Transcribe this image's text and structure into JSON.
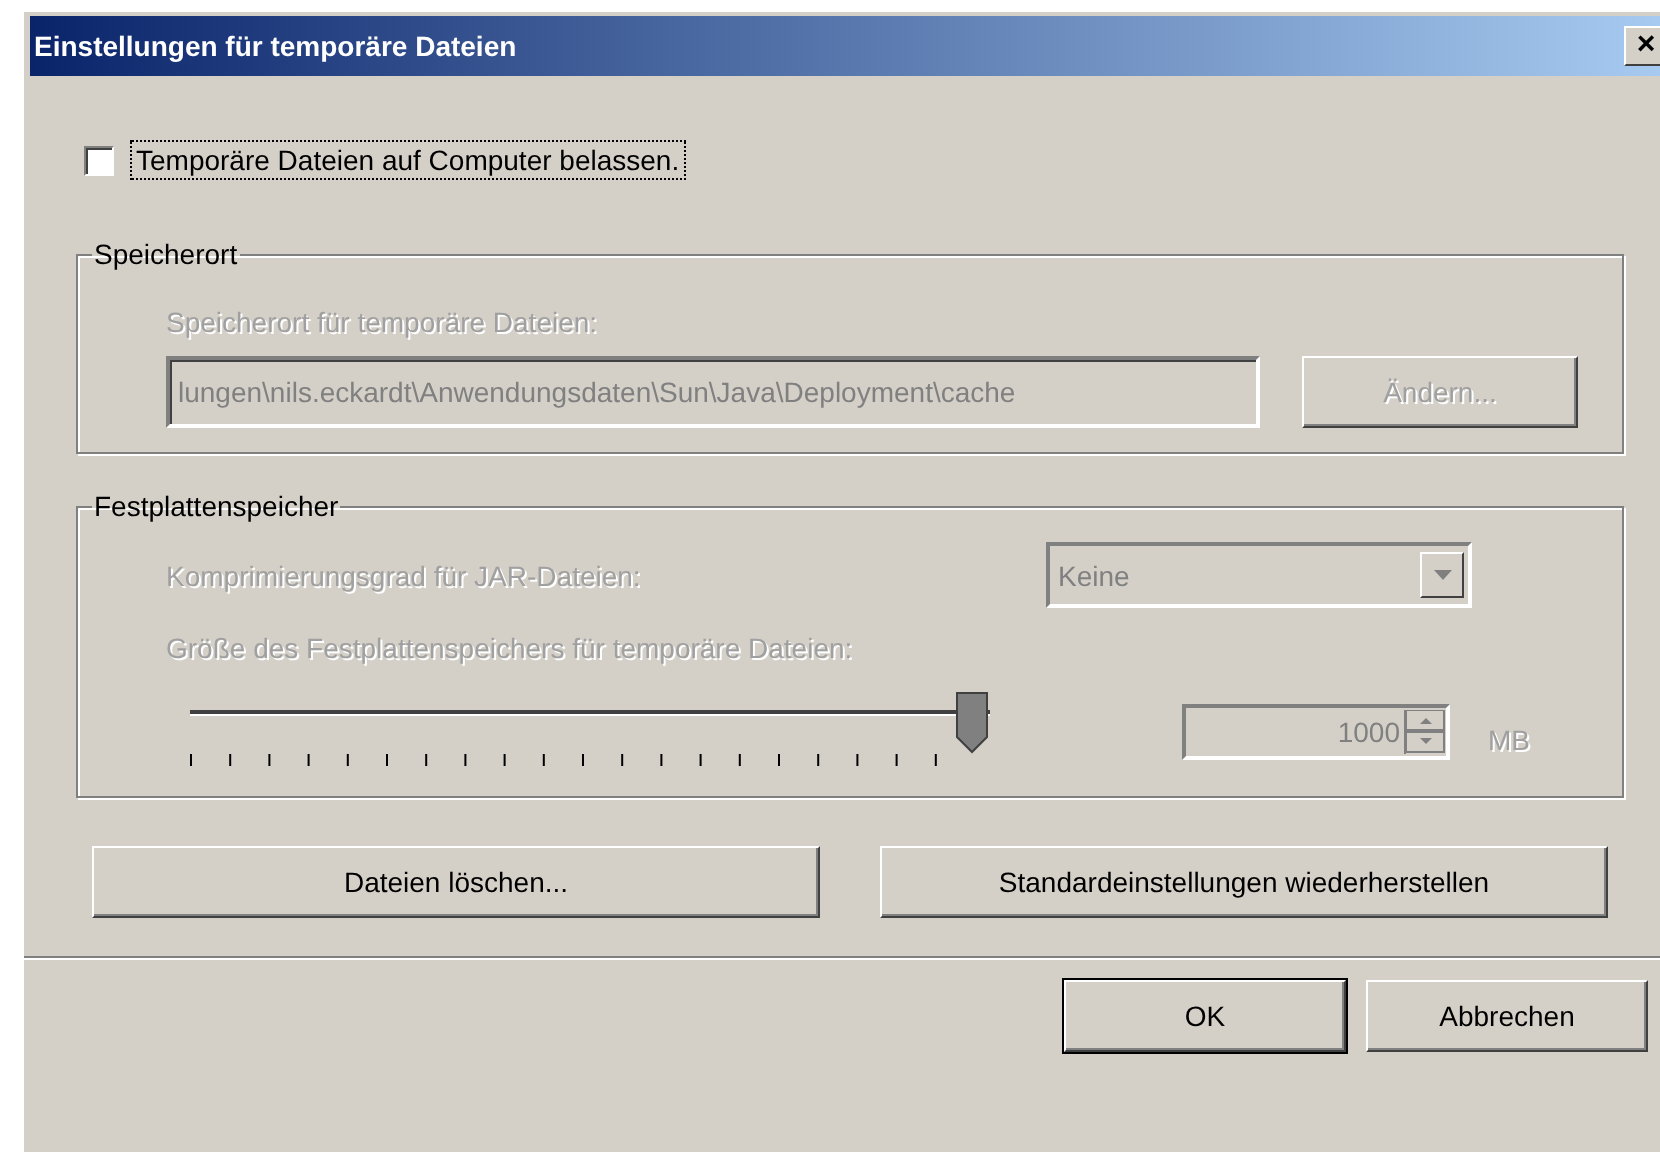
{
  "window": {
    "title": "Einstellungen für temporäre Dateien",
    "close": "×"
  },
  "keep_files": {
    "label": "Temporäre Dateien auf Computer belassen.",
    "checked": false
  },
  "location": {
    "title": "Speicherort",
    "label": "Speicherort für temporäre Dateien:",
    "value": "lungen\\nils.eckardt\\Anwendungsdaten\\Sun\\Java\\Deployment\\cache",
    "button": "Ändern...",
    "disabled": true
  },
  "disk": {
    "title": "Festplattenspeicher",
    "compression_label": "Komprimierungsgrad für JAR-Dateien:",
    "compression": "Keine",
    "size_label": "Größe des Festplattenspeichers für temporäre Dateien:",
    "size": {
      "level": 1.0
    },
    "size_value": "1000",
    "unit": "MB",
    "disabled": true
  },
  "buttons": [
    {
      "label": "Dateien löschen..."
    },
    {
      "label": "Standardeinstellungen wiederherstellen"
    }
  ],
  "footer": [
    {
      "label": "OK",
      "default": true
    },
    {
      "label": "Abbrechen",
      "default": false
    }
  ]
}
